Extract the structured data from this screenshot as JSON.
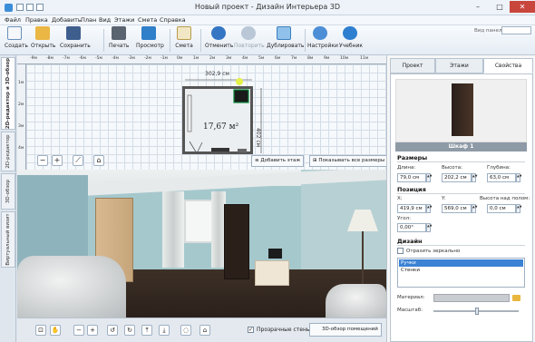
{
  "window": {
    "title": "Новый проект - Дизайн Интерьера 3D",
    "minimize": "–",
    "maximize": "□",
    "close": "✕"
  },
  "menu": [
    "Файл",
    "Правка",
    "Добавить",
    "План",
    "Вид",
    "Этажи",
    "Смета",
    "Справка"
  ],
  "toolbar": {
    "buttons": [
      {
        "label": "Создать",
        "icon": "new-document-icon"
      },
      {
        "label": "Открыть",
        "icon": "open-folder-icon"
      },
      {
        "label": "Сохранить",
        "icon": "save-disk-icon"
      },
      {
        "label": "Печать",
        "icon": "printer-icon"
      },
      {
        "label": "Просмотр",
        "icon": "monitor-preview-icon"
      },
      {
        "label": "Смета",
        "icon": "estimate-notepad-icon"
      },
      {
        "label": "Отменить",
        "icon": "undo-arrow-icon"
      },
      {
        "label": "Повторить",
        "icon": "redo-arrow-icon"
      },
      {
        "label": "Дублировать",
        "icon": "duplicate-icon"
      },
      {
        "label": "Настройки",
        "icon": "gear-icon"
      },
      {
        "label": "Учебник",
        "icon": "help-icon"
      }
    ],
    "view_panels_label": "Вид панели:",
    "view_panels_value": ""
  },
  "side_tabs": [
    "2D-редактор и 3D-обзор",
    "2D-редактор",
    "3D-обзор",
    "Виртуальный визит"
  ],
  "plan": {
    "ruler_top": [
      "-9м",
      "-8м",
      "-7м",
      "-6м",
      "-5м",
      "-4м",
      "-3м",
      "-2м",
      "-1м",
      "0м",
      "1м",
      "2м",
      "3м",
      "4м",
      "5м",
      "6м",
      "7м",
      "8м",
      "9м",
      "10м",
      "11м"
    ],
    "ruler_left": [
      "1м",
      "2м",
      "3м",
      "4м"
    ],
    "area_label": "17,67 м²",
    "width_label": "302,9 см",
    "height_label": "402 см",
    "add_floor": "Добавить этаж",
    "show_all_sizes": "Показывать все размеры"
  },
  "bottom": {
    "transparent_walls": "Прозрачные стены",
    "room_overview": "3D-обзор помещений"
  },
  "props": {
    "tabs": [
      "Проект",
      "Этажи",
      "Свойства"
    ],
    "object_name": "Шкаф 1",
    "sizes_title": "Размеры",
    "length_label": "Длина:",
    "length_value": "79,0 см",
    "height_label": "Высота:",
    "height_value": "202,2 см",
    "depth_label": "Глубина:",
    "depth_value": "63,0 см",
    "position_title": "Позиция",
    "x_label": "X:",
    "x_value": "419,9 см",
    "y_label": "Y:",
    "y_value": "569,0 см",
    "floor_height_label": "Высота над полом:",
    "floor_height_value": "0,0 см",
    "angle_label": "Угол:",
    "angle_value": "0,00°",
    "design_title": "Дизайн",
    "mirror_label": "Отразить зеркально",
    "parts": [
      "Ручки",
      "Стенки"
    ],
    "material_label": "Материал:",
    "scale_label": "Масштаб:"
  }
}
